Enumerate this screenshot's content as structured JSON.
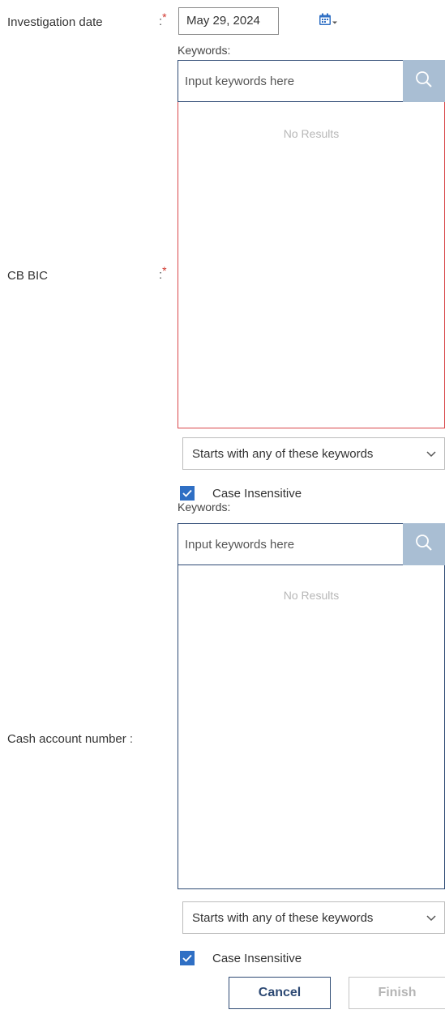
{
  "investigation_date": {
    "label": "Investigation date",
    "colon": ":",
    "required": "*",
    "value": "May 29, 2024"
  },
  "cb_bic": {
    "label": "CB BIC",
    "colon": ":",
    "required": "*",
    "keywords_label": "Keywords:",
    "search_placeholder": "Input keywords here",
    "no_results": "No Results",
    "match_mode": "Starts with any of these keywords",
    "case_insensitive_label": "Case Insensitive",
    "case_insensitive_checked": true
  },
  "cash_account_number": {
    "label": "Cash account number",
    "colon": ":",
    "keywords_label": "Keywords:",
    "search_placeholder": "Input keywords here",
    "no_results": "No Results",
    "match_mode": "Starts with any of these keywords",
    "case_insensitive_label": "Case Insensitive",
    "case_insensitive_checked": true
  },
  "actions": {
    "cancel_label": "Cancel",
    "finish_label": "Finish"
  },
  "colors": {
    "accent": "#2e4a74",
    "error_border": "#d9474b",
    "search_button": "#a9bed3",
    "checkbox": "#2f6fc4",
    "required": "#d0342c"
  },
  "icons": {
    "calendar": "calendar-icon",
    "calendar_dropdown": "caret-down-icon",
    "search": "search-icon",
    "select_chevron": "chevron-down-icon",
    "checkmark": "checkmark-icon"
  }
}
